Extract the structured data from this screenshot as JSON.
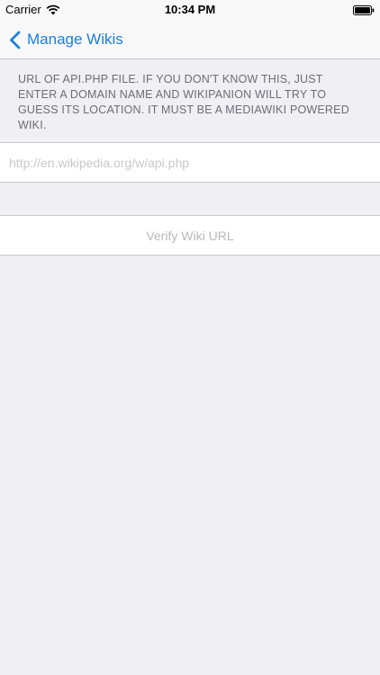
{
  "status_bar": {
    "carrier": "Carrier",
    "time": "10:34 PM",
    "wifi_icon": "wifi-icon",
    "battery_icon": "battery-icon"
  },
  "nav": {
    "back_label": "Manage Wikis",
    "back_icon": "chevron-left-icon",
    "accent_color": "#1a80e0"
  },
  "form": {
    "section_header": "URL OF API.PHP FILE. IF YOU DON'T KNOW THIS, JUST ENTER A DOMAIN NAME AND WIKIPANION WILL TRY TO GUESS ITS LOCATION. IT MUST BE A MEDIAWIKI POWERED WIKI.",
    "url_value": "",
    "url_placeholder": "http://en.wikipedia.org/w/api.php",
    "verify_label": "Verify Wiki URL"
  }
}
